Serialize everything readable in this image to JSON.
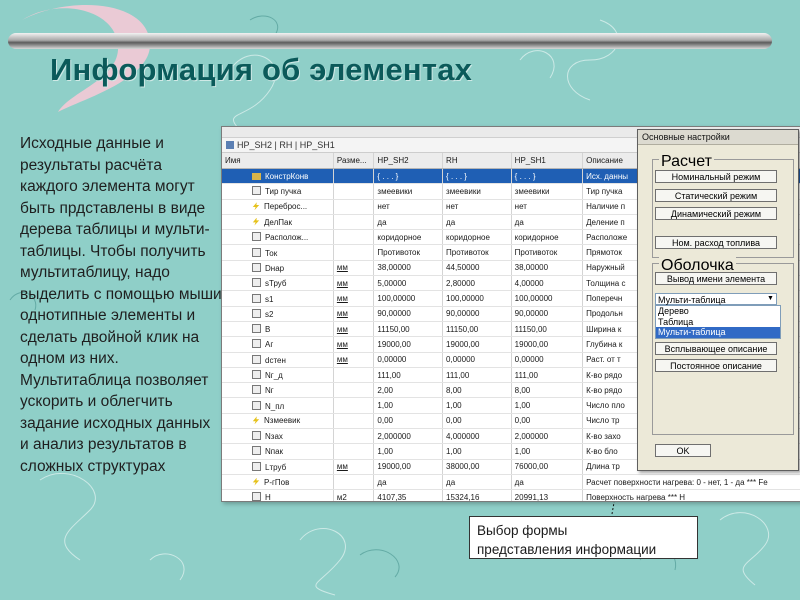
{
  "slide": {
    "title": "Информация об элементах",
    "paragraph_lines": [
      "Исходные данные и",
      "результаты расчёта",
      "каждого элемента могут",
      "быть прдставлены в виде",
      "дерева таблицы и мульти-",
      "таблицы. Чтобы получить",
      "мультитаблицу, надо",
      "выделить с помощью мыши",
      "однотипные элементы и",
      "сделать двойной клик на",
      "одном из них.",
      "Мультитаблица позволяет",
      "ускорить  и облегчить",
      "задание исходных данных",
      "и анализ результатов в",
      "сложных структурах"
    ],
    "callout_lines": [
      "Выбор формы",
      "представления информации"
    ]
  },
  "window": {
    "tab_path": "HP_SH2 | RH | HP_SH1",
    "columns": [
      "Имя",
      "Разме...",
      "HP_SH2",
      "RH",
      "HP_SH1",
      "Описание"
    ],
    "rows": [
      {
        "icon": "folder",
        "name": "КонстрКонв",
        "unit": "",
        "v1": "{ . . . }",
        "v2": "{ . . . }",
        "v3": "{ . . . }",
        "desc": "Исх. данны",
        "selected": true
      },
      {
        "icon": "box",
        "name": "Тир пучка",
        "unit": "",
        "v1": "змеевики",
        "v2": "змеевики",
        "v3": "змеевики",
        "desc": "Тир пучка"
      },
      {
        "icon": "bolt",
        "name": "Переброс...",
        "unit": "",
        "v1": "нет",
        "v2": "нет",
        "v3": "нет",
        "desc": "Наличие п"
      },
      {
        "icon": "bolt",
        "name": "ДелПак",
        "unit": "",
        "v1": "да",
        "v2": "да",
        "v3": "да",
        "desc": "Деление п"
      },
      {
        "icon": "box",
        "name": "Располож...",
        "unit": "",
        "v1": "коридорное",
        "v2": "коридорное",
        "v3": "коридорное",
        "desc": "Расположе"
      },
      {
        "icon": "box",
        "name": "Ток",
        "unit": "",
        "v1": "Противоток",
        "v2": "Противоток",
        "v3": "Противоток",
        "desc": "Прямоток"
      },
      {
        "icon": "box",
        "name": "Dнар",
        "unit": "мм",
        "v1": "38,00000",
        "v2": "44,50000",
        "v3": "38,00000",
        "desc": "Наружный"
      },
      {
        "icon": "box",
        "name": "sТруб",
        "unit": "мм",
        "v1": "5,00000",
        "v2": "2,80000",
        "v3": "4,00000",
        "desc": "Толщина с"
      },
      {
        "icon": "box",
        "name": "s1",
        "unit": "мм",
        "v1": "100,00000",
        "v2": "100,00000",
        "v3": "100,00000",
        "desc": "Поперечн"
      },
      {
        "icon": "box",
        "name": "s2",
        "unit": "мм",
        "v1": "90,00000",
        "v2": "90,00000",
        "v3": "90,00000",
        "desc": "Продольн"
      },
      {
        "icon": "box",
        "name": "B",
        "unit": "мм",
        "v1": "11150,00",
        "v2": "11150,00",
        "v3": "11150,00",
        "desc": "Ширина к"
      },
      {
        "icon": "box",
        "name": "Aг",
        "unit": "мм",
        "v1": "19000,00",
        "v2": "19000,00",
        "v3": "19000,00",
        "desc": "Глубина к"
      },
      {
        "icon": "box",
        "name": "dстен",
        "unit": "мм",
        "v1": "0,00000",
        "v2": "0,00000",
        "v3": "0,00000",
        "desc": "Раст. от т"
      },
      {
        "icon": "box",
        "name": "Nг_д",
        "unit": "",
        "v1": "111,00",
        "v2": "111,00",
        "v3": "111,00",
        "desc": "К-во рядо"
      },
      {
        "icon": "box",
        "name": "Nг",
        "unit": "",
        "v1": "2,00",
        "v2": "8,00",
        "v3": "8,00",
        "desc": "К-во рядо"
      },
      {
        "icon": "box",
        "name": "N_пл",
        "unit": "",
        "v1": "1,00",
        "v2": "1,00",
        "v3": "1,00",
        "desc": "Число пло"
      },
      {
        "icon": "bolt",
        "name": "Nзмеевик",
        "unit": "",
        "v1": "0,00",
        "v2": "0,00",
        "v3": "0,00",
        "desc": "Число тр"
      },
      {
        "icon": "box",
        "name": "Nзах",
        "unit": "",
        "v1": "2,000000",
        "v2": "4,000000",
        "v3": "2,000000",
        "desc": "К-во захо"
      },
      {
        "icon": "box",
        "name": "Nпак",
        "unit": "",
        "v1": "1,00",
        "v2": "1,00",
        "v3": "1,00",
        "desc": "К-во бло"
      },
      {
        "icon": "box",
        "name": "Lтруб",
        "unit": "мм",
        "v1": "19000,00",
        "v2": "38000,00",
        "v3": "76000,00",
        "desc": "Длина тр"
      },
      {
        "icon": "bolt",
        "name": "P-гПов",
        "unit": "",
        "v1": "да",
        "v2": "да",
        "v3": "да",
        "desc": "Расчет поверхности нагрева: 0 - нет, 1 - да *** Fe"
      },
      {
        "icon": "box",
        "name": "H",
        "unit": "м2",
        "v1": "4107,35",
        "v2": "15324,16",
        "v3": "20991,13",
        "desc": "Поверхность нагрева *** H"
      }
    ]
  },
  "dialog": {
    "title": "Основные настройки",
    "group_calc": "Расчет",
    "buttons_calc": [
      "Номинальный режим",
      "Статический режим",
      "Динамический режим"
    ],
    "fuel_button": "Ном. расход топлива",
    "group_shell": "Оболочка",
    "show_name_button": "Вывод имени элемента",
    "combo_value": "Мульти-таблица",
    "dropdown_options": [
      "Дерево",
      "Таблица",
      "Мульти-таблица"
    ],
    "popup_button": "Всплывающее описание",
    "const_button": "Постоянное описание",
    "ok_button": "OK"
  }
}
